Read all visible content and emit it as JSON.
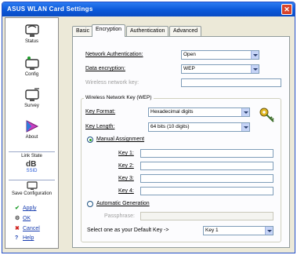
{
  "window": {
    "title": "ASUS WLAN Card Settings"
  },
  "sidebar": {
    "items": [
      {
        "label": "Status",
        "icon": "status-icon"
      },
      {
        "label": "Config",
        "icon": "config-icon"
      },
      {
        "label": "Survey",
        "icon": "survey-icon"
      },
      {
        "label": "About",
        "icon": "about-icon"
      }
    ],
    "link_state": {
      "label": "Link State",
      "sub": "SSID"
    },
    "save_config": "Save Configuration",
    "actions": {
      "apply": "Apply",
      "ok": "OK",
      "cancel": "Cancel",
      "help": "Help"
    }
  },
  "tabs": [
    "Basic",
    "Encryption",
    "Authentication",
    "Advanced"
  ],
  "active_tab": "Encryption",
  "form": {
    "network_auth_label": "Network Authentication:",
    "network_auth_value": "Open",
    "data_encryption_label": "Data encryption:",
    "data_encryption_value": "WEP",
    "wireless_key_label": "Wireless network key:",
    "group_title": "Wireless Network Key (WEP)",
    "key_format_label": "Key Format:",
    "key_format_value": "Hexadecimal digits",
    "key_length_label": "Key Length:",
    "key_length_value": "64 bits (10 digits)",
    "manual_label": "Manual Assignment",
    "keys": [
      "Key 1:",
      "Key 2:",
      "Key 3:",
      "Key 4:"
    ],
    "auto_gen_label": "Automatic Generation",
    "passphrase_label": "Passphrase:",
    "default_key_label": "Select one as your Default Key ->",
    "default_key_value": "Key 1"
  },
  "colors": {
    "titlebar": "#0b58d9",
    "panel": "#fcfcfe",
    "window": "#ece9d8"
  }
}
